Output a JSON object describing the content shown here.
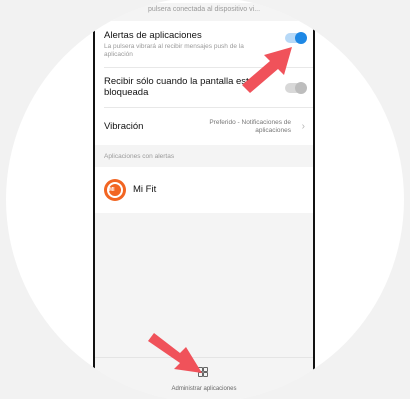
{
  "status_strip": {
    "text": "pulsera conectada al dispositivo vi..."
  },
  "settings": {
    "app_alerts": {
      "title": "Alertas de aplicaciones",
      "subtitle": "La pulsera vibrará al recibir mensajes push de la aplicación",
      "enabled": true
    },
    "locked_only": {
      "title": "Recibir sólo cuando la pantalla esté bloqueada",
      "enabled": false
    },
    "vibration": {
      "title": "Vibración",
      "value": "Preferido - Notificaciones de aplicaciones"
    }
  },
  "apps_section": {
    "header": "Aplicaciones con alertas",
    "items": [
      {
        "name": "Mi Fit",
        "icon": "mi-fit-app-icon",
        "icon_text": "MI"
      }
    ]
  },
  "bottom_bar": {
    "label": "Administrar aplicaciones",
    "icon": "grid-icon"
  },
  "colors": {
    "accent": "#1e88e5",
    "arrow": "#f0525a",
    "app_icon": "#f26522"
  }
}
